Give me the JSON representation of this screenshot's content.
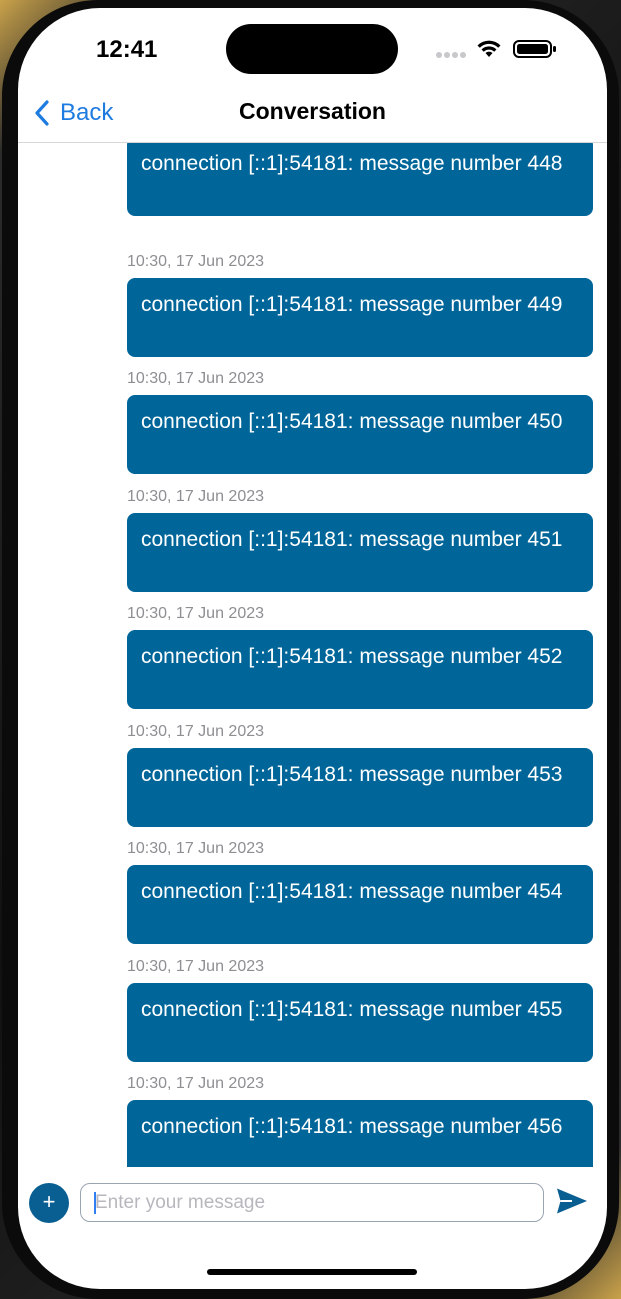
{
  "status_bar": {
    "time": "12:41"
  },
  "nav": {
    "back_label": "Back",
    "title": "Conversation"
  },
  "messages": [
    {
      "timestamp": "",
      "text": "connection [::1]:54181: message number 448"
    },
    {
      "timestamp": "10:30, 17 Jun 2023",
      "text": "connection [::1]:54181: message number 449"
    },
    {
      "timestamp": "10:30, 17 Jun 2023",
      "text": "connection [::1]:54181: message number 450"
    },
    {
      "timestamp": "10:30, 17 Jun 2023",
      "text": "connection [::1]:54181: message number 451"
    },
    {
      "timestamp": "10:30, 17 Jun 2023",
      "text": "connection [::1]:54181: message number 452"
    },
    {
      "timestamp": "10:30, 17 Jun 2023",
      "text": "connection [::1]:54181: message number 453"
    },
    {
      "timestamp": "10:30, 17 Jun 2023",
      "text": "connection [::1]:54181: message number 454"
    },
    {
      "timestamp": "10:30, 17 Jun 2023",
      "text": "connection [::1]:54181: message number 455"
    },
    {
      "timestamp": "10:30, 17 Jun 2023",
      "text": "connection [::1]:54181: message number 456"
    }
  ],
  "composer": {
    "add_icon": "+",
    "placeholder": "Enter your message",
    "value": ""
  },
  "icons": {
    "back": "chevron-left-icon",
    "signal": "cellular-signal-icon",
    "wifi": "wifi-icon",
    "battery": "battery-icon",
    "add": "plus-icon",
    "send": "send-icon"
  },
  "colors": {
    "accent": "#1e7be0",
    "bubble": "#006699",
    "add_button": "#0a5f92",
    "timestamp": "#8e8e93"
  }
}
